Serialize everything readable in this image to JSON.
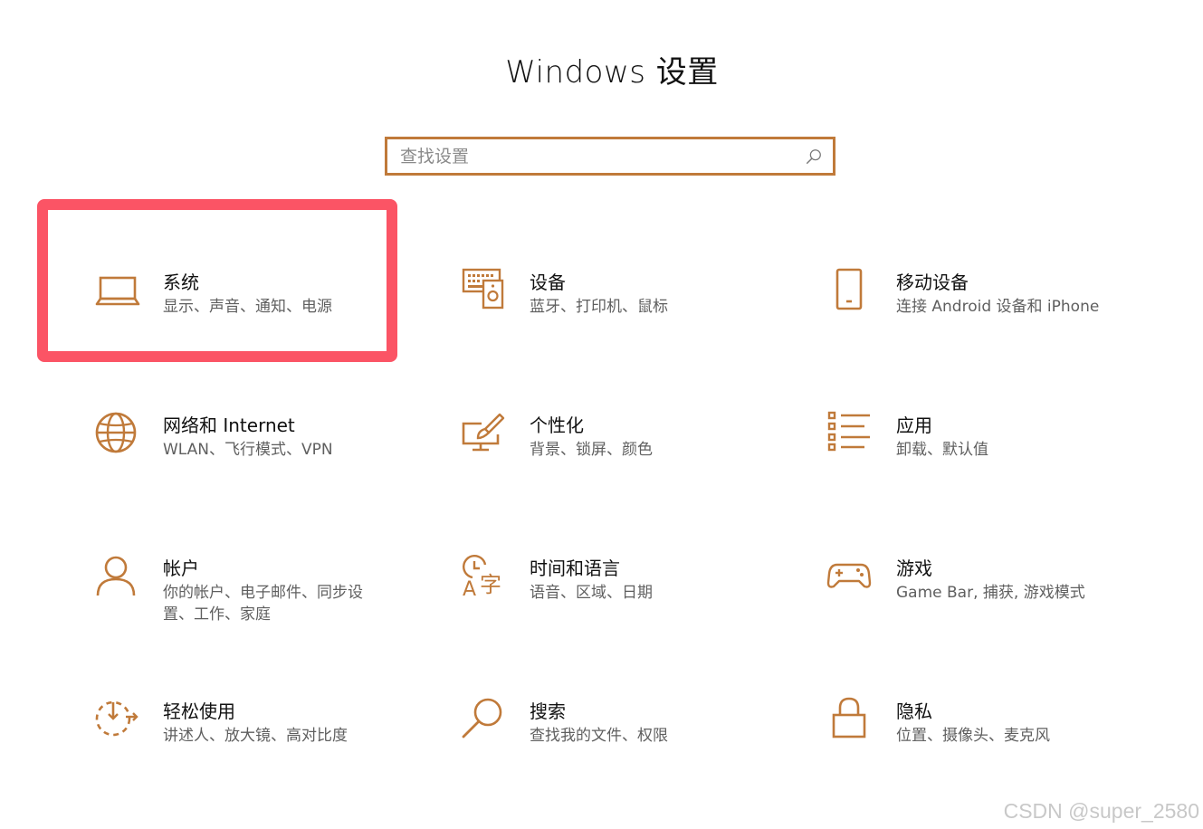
{
  "window": {
    "title": "Windows 设置"
  },
  "search": {
    "placeholder": "查找设置"
  },
  "accent_color": "#c07a3a",
  "highlight_color": "#fb5465",
  "tiles": [
    {
      "name": "系统",
      "desc": "显示、声音、通知、电源",
      "icon": "laptop-icon"
    },
    {
      "name": "设备",
      "desc": "蓝牙、打印机、鼠标",
      "icon": "keyboard-speaker-icon"
    },
    {
      "name": "移动设备",
      "desc": "连接 Android 设备和 iPhone",
      "icon": "phone-icon"
    },
    {
      "name": "网络和 Internet",
      "desc": "WLAN、飞行模式、VPN",
      "icon": "globe-icon"
    },
    {
      "name": "个性化",
      "desc": "背景、锁屏、颜色",
      "icon": "paint-brush-icon"
    },
    {
      "name": "应用",
      "desc": "卸载、默认值",
      "icon": "app-list-icon"
    },
    {
      "name": "帐户",
      "desc": "你的帐户、电子邮件、同步设置、工作、家庭",
      "icon": "person-icon"
    },
    {
      "name": "时间和语言",
      "desc": "语音、区域、日期",
      "icon": "clock-language-icon"
    },
    {
      "name": "游戏",
      "desc": "Game Bar, 捕获, 游戏模式",
      "icon": "gamepad-icon"
    },
    {
      "name": "轻松使用",
      "desc": "讲述人、放大镜、高对比度",
      "icon": "ease-of-access-icon"
    },
    {
      "name": "搜索",
      "desc": "查找我的文件、权限",
      "icon": "magnifier-icon"
    },
    {
      "name": "隐私",
      "desc": "位置、摄像头、麦克风",
      "icon": "lock-icon"
    }
  ],
  "watermark": "CSDN @super_2580"
}
